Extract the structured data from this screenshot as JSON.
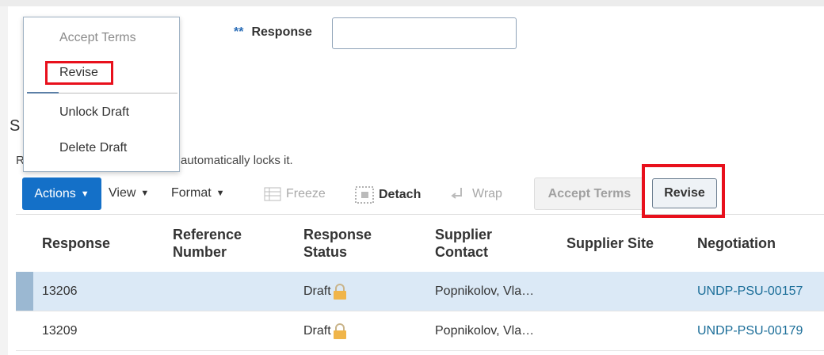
{
  "search": {
    "required_marker": "**",
    "label": "Response",
    "value": ""
  },
  "section": {
    "title_visible": "S",
    "help_start": "R",
    "help_end": "automatically locks it."
  },
  "dropdown": {
    "items": [
      {
        "label": "Accept Terms",
        "disabled": true
      },
      {
        "label": "Revise",
        "disabled": false
      },
      {
        "label": "Unlock Draft",
        "disabled": false
      },
      {
        "label": "Delete Draft",
        "disabled": false
      }
    ]
  },
  "toolbar": {
    "actions": "Actions",
    "view": "View",
    "format": "Format",
    "freeze": "Freeze",
    "detach": "Detach",
    "wrap": "Wrap",
    "accept_terms": "Accept Terms",
    "revise": "Revise"
  },
  "table": {
    "columns": [
      "Response",
      "Reference Number",
      "Response Status",
      "Supplier Contact",
      "Supplier Site",
      "Negotiation"
    ],
    "rows": [
      {
        "response": "13206",
        "reference_number": "",
        "status": "Draft",
        "supplier_contact": "Popnikolov, Vla…",
        "supplier_site": "",
        "negotiation": "UNDP-PSU-00157"
      },
      {
        "response": "13209",
        "reference_number": "",
        "status": "Draft",
        "supplier_contact": "Popnikolov, Vla…",
        "supplier_site": "",
        "negotiation": "UNDP-PSU-00179"
      }
    ]
  },
  "colors": {
    "accent": "#1470c8",
    "highlight": "#e8101c",
    "link": "#1a6d98",
    "selected_row": "#dbe9f6"
  }
}
